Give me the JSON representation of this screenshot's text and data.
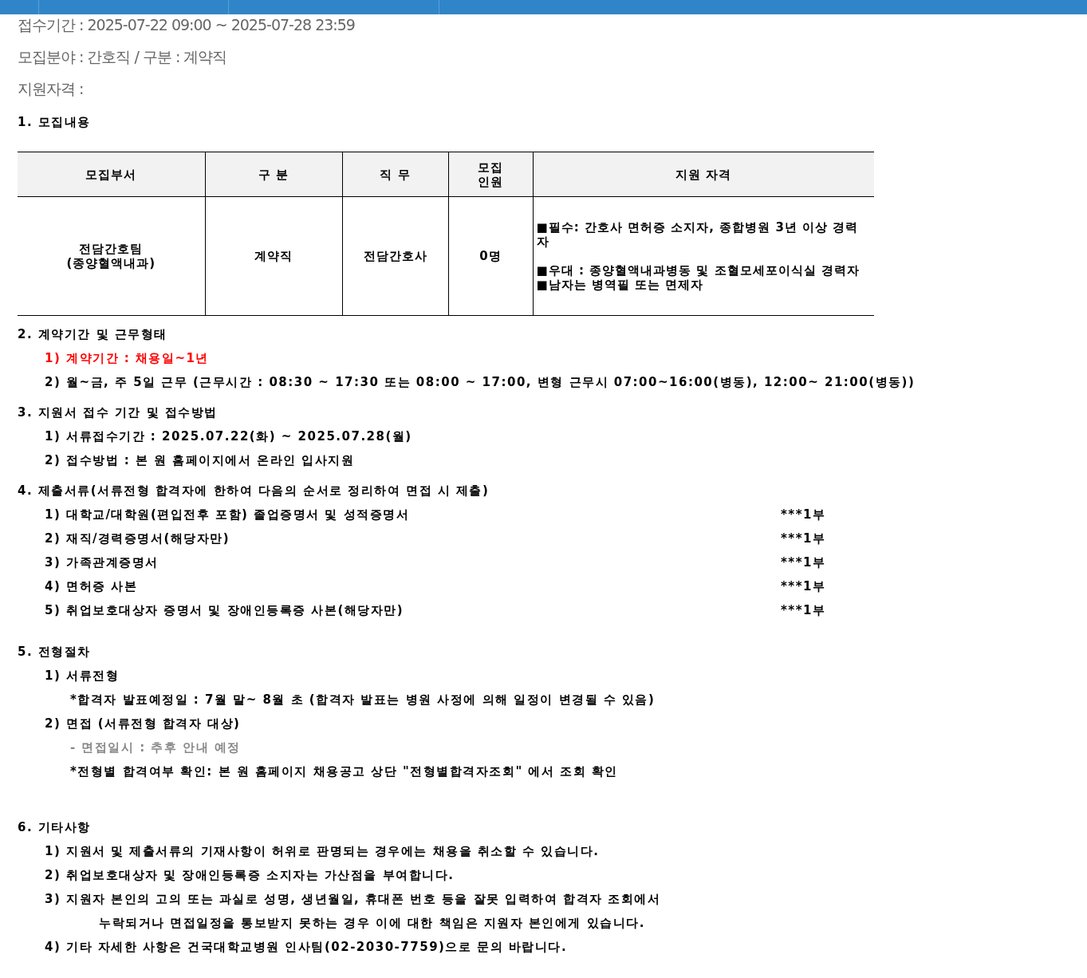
{
  "info_lines": [
    "접수기간 : 2025-07-22 09:00 ~ 2025-07-28 23:59",
    "모집분야 : 간호직 / 구분 : 계약직",
    "지원자격 :"
  ],
  "sections": [
    {
      "heading": "1. 모집내용",
      "table": {
        "columns": [
          "모집부서",
          "구  분",
          "직  무",
          "모집\n인원",
          "지원 자격"
        ],
        "rows": [
          {
            "cells": [
              "전담간호팀\n(종양혈액내과)",
              "계약직",
              "전담간호사",
              "0명",
              "■필수: 간호사 면허증 소지자, 종합병원 3년 이상 경력자\n\n■우대 : 종양혈액내과병동 및 조혈모세포이식실 경력자\n■남자는 병역필 또는 면제자"
            ]
          }
        ]
      }
    },
    {
      "heading": "2. 계약기간 및 근무형태",
      "items": [
        {
          "kind": "highlight",
          "text": "1) 계약기간 : 채용일~1년"
        },
        {
          "kind": "plain",
          "text": "2) 월~금, 주 5일 근무 (근무시간 : 08:30 ~ 17:30 또는 08:00 ~ 17:00, 변형 근무시 07:00~16:00(병동), 12:00~ 21:00(병동))"
        }
      ]
    },
    {
      "heading": "3. 지원서 접수 기간 및 접수방법",
      "items": [
        {
          "kind": "plain",
          "text": "1) 서류접수기간 : 2025.07.22(화) ~ 2025.07.28(월)"
        },
        {
          "kind": "plain",
          "text": "2) 접수방법 : 본 원 홈페이지에서 온라인 입사지원"
        }
      ]
    },
    {
      "heading": "4. 제출서류(서류전형 합격자에 한하여 다음의 순서로 정리하여 면접 시 제출)",
      "items": [
        {
          "kind": "document",
          "text": "1) 대학교/대학원(편입전후 포함) 졸업증명서 및 성적증명서",
          "count": "***1부"
        },
        {
          "kind": "document",
          "text": "2) 재직/경력증명서(해당자만)",
          "count": "***1부"
        },
        {
          "kind": "document",
          "text": "3) 가족관계증명서",
          "count": "***1부"
        },
        {
          "kind": "document",
          "text": "4) 면허증 사본",
          "count": "***1부"
        },
        {
          "kind": "document",
          "text": "5) 취업보호대상자 증명서 및 장애인등록증 사본(해당자만)",
          "count": "***1부"
        }
      ]
    },
    {
      "heading": "5. 전형절차",
      "items": [
        {
          "kind": "plain",
          "text": "1) 서류전형",
          "children": [
            {
              "kind": "plain",
              "text": "*합격자 발표예정일 : 7월 말~ 8월 초 (합격자 발표는 병원 사정에 의해 일정이 변경될 수 있음)"
            }
          ]
        },
        {
          "kind": "plain",
          "text": "2) 면접 (서류전형 합격자 대상)",
          "children": [
            {
              "kind": "muted",
              "text": "- 면접일시 : 추후 안내 예정"
            },
            {
              "kind": "plain",
              "text": "*전형별 합격여부 확인: 본 원 홈페이지 채용공고 상단 \"전형별합격자조회\" 에서 조회 확인"
            }
          ]
        }
      ]
    },
    {
      "heading": "6. 기타사항",
      "items": [
        {
          "kind": "plain",
          "text": "1) 지원서 및 제출서류의 기재사항이 허위로 판명되는 경우에는 채용을 취소할 수 있습니다."
        },
        {
          "kind": "plain",
          "text": "2) 취업보호대상자 및 장애인등록증 소지자는 가산점을 부여합니다."
        },
        {
          "kind": "plain",
          "text": "3) 지원자 본인의 고의 또는 과실로 성명, 생년월일, 휴대폰 번호 등을 잘못 입력하여 합격자 조회에서",
          "continued": "누락되거나 면접일정을 통보받지 못하는 경우 이에 대한 책임은 지원자 본인에게 있습니다."
        },
        {
          "kind": "plain",
          "text": "4) 기타 자세한 사항은 건국대학교병원 인사팀(02-2030-7759)으로 문의 바랍니다."
        }
      ]
    }
  ]
}
